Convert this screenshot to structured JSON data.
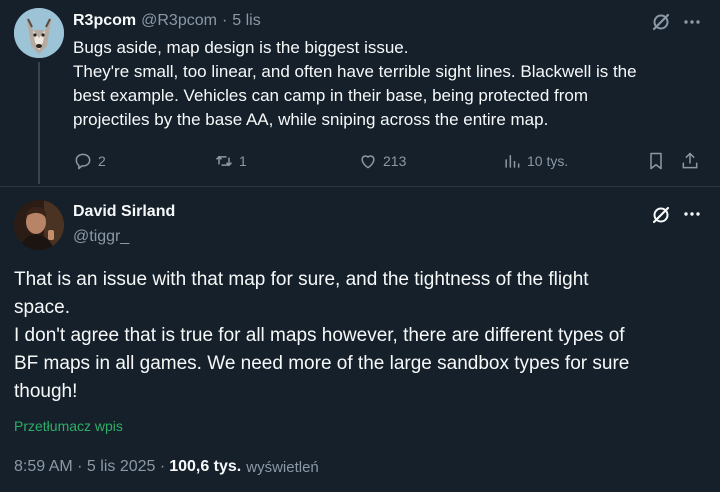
{
  "reply": {
    "name": "R3pcom",
    "handle": "@R3pcom",
    "separator": "·",
    "time": "5 lis",
    "text_lines": [
      "Bugs aside, map design is the biggest issue.",
      "They're small, too linear, and often have terrible sight lines. Blackwell is the",
      "best example. Vehicles can camp in their base, being protected from",
      "projectiles by the base AA, while sniping across the entire map."
    ],
    "actions": {
      "replies": "2",
      "reposts": "1",
      "likes": "213",
      "views": "10 tys."
    }
  },
  "main": {
    "name": "David Sirland",
    "handle": "@tiggr_",
    "text_lines": [
      "That is an issue with that map for sure, and the tightness of the flight",
      "space.",
      "I don't agree that is true for all maps however, there are different types of",
      "BF maps in all games. We need more of the large sandbox types for sure",
      "though!"
    ],
    "translate_label": "Przetłumacz wpis",
    "timestamp": "8:59 AM · 5 lis 2025 ·",
    "views_count": "100,6 tys.",
    "views_label": "wyświetleń"
  },
  "colors": {
    "background": "#15202b",
    "text": "#f7f9f9",
    "muted": "#8b98a5",
    "divider": "#2a3640"
  },
  "icons": {
    "grok": "grok-icon",
    "more": "more-icon",
    "reply": "reply-icon",
    "repost": "repost-icon",
    "like": "like-icon",
    "views": "views-icon",
    "bookmark": "bookmark-icon",
    "share": "share-icon"
  }
}
